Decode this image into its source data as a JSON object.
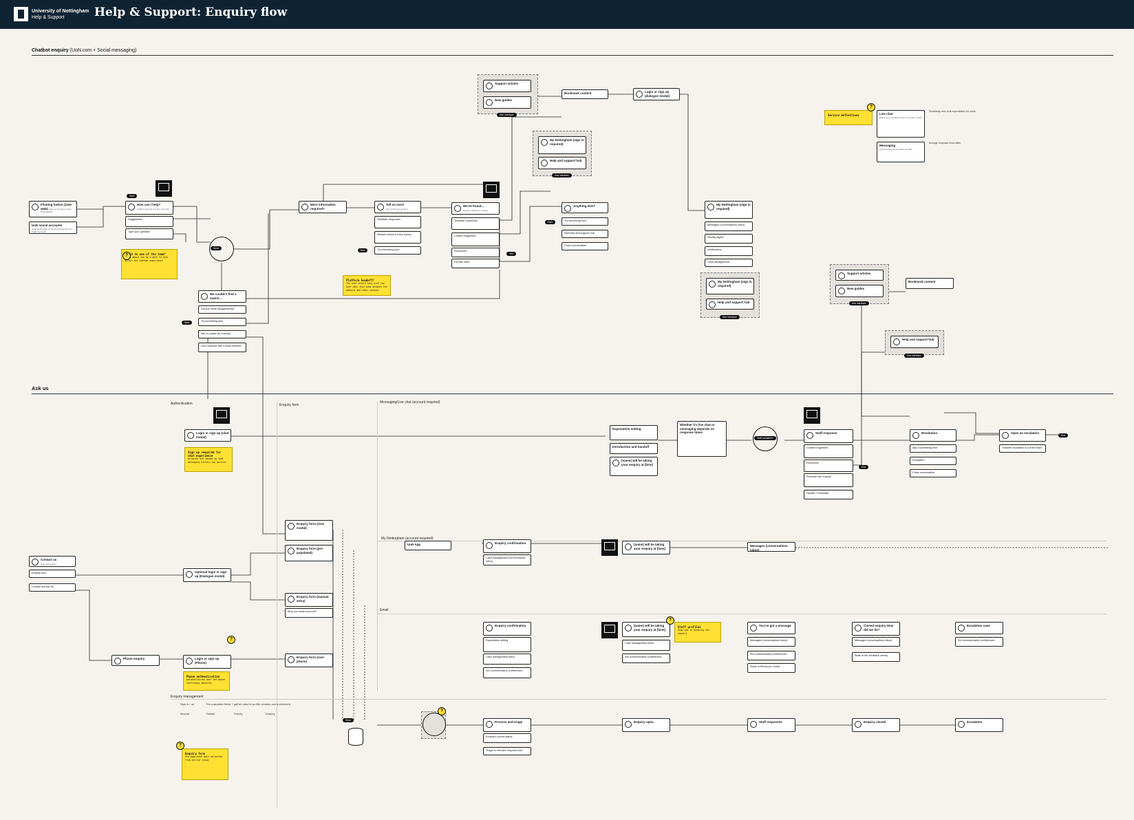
{
  "header": {
    "org_name": "University of Nottingham",
    "org_sub": "Help & Support",
    "title": "Help & Support: Enquiry flow"
  },
  "sections": {
    "chatbot": {
      "title": "Chatbot enquiry",
      "subtitle": "(UoN.com + Social messaging)"
    },
    "ask_us": {
      "title": "Ask us"
    },
    "authentication": "Authentication",
    "enquiry_form": "Enquiry form",
    "messaging": "Messaging/Live chat",
    "messaging_note": "(account required)",
    "my_nottingham": "My Nottingham",
    "my_nottingham_note": "(account required)",
    "email": "Email",
    "enquiry_management": "Enquiry management"
  },
  "chatbot_nodes": {
    "floating_button": {
      "title": "Floating button (UoN web)",
      "sub": "Visible prompt on all pages of the UoN website"
    },
    "uon_social": {
      "title": "UoN social accounts",
      "sub": "Chat functionality on the UoN Facebook and Twitter accounts"
    },
    "how_help": {
      "title": "How can I help?",
      "sub": "Chatbot greeting and free text input"
    },
    "suggestions": {
      "title": "Suggestions",
      "sub": "Popular topics and quick replies"
    },
    "type_question": {
      "title": "Type your question",
      "sub": "Natural language input"
    },
    "more_info": {
      "title": "More information required?"
    },
    "tell_us_more": {
      "title": "Tell us more",
      "sub": "Ask a follow up question"
    },
    "template_responses": {
      "title": "Template responses"
    },
    "multiple_choice": {
      "title": "Multiple choice (of key topics)"
    },
    "try_rephrasing": {
      "title": "Try rephrasing your"
    },
    "we_found": {
      "title": "We've found…",
      "sub": "Results matched to enquiry"
    },
    "template_resp2": {
      "title": "Template responses"
    },
    "content_fragments": {
      "title": "Content fragments"
    },
    "resources": {
      "title": "Resources"
    },
    "did_this_help": {
      "title": "Did this help?"
    },
    "anything_else": {
      "title": "Anything else?"
    },
    "try_something_new": {
      "title": "Try something new"
    },
    "visit_help": {
      "title": "Visit help and support hub"
    },
    "close_conversation": {
      "title": "Close conversation"
    },
    "couldnt_find": {
      "title": "We couldn't find a match…"
    },
    "did_you_mean": {
      "title": "Did you mean [suggestions]?"
    },
    "try_something_else": {
      "title": "Try something else"
    },
    "ask_us": {
      "title": "Ask us (make an enquiry)"
    },
    "live_chat": {
      "title": "Live chat/chat with a team member"
    },
    "bookmark_content": {
      "title": "Bookmark content",
      "sub": "Save this article to your account"
    },
    "login_signup_modal": {
      "title": "Login or sign up (dialogue modal)"
    },
    "support_articles": {
      "title": "Support articles"
    },
    "new_guides": {
      "title": "New guides"
    },
    "my_nottingham_signin": {
      "title": "My Nottingham (sign in required)"
    },
    "help_support_hub": {
      "title": "Help and support hub"
    },
    "my_nottingham_main": {
      "title": "My Nottingham (sign in required)"
    },
    "messages_conv": {
      "title": "Messages (conversations inbox)"
    },
    "weekly_digest": {
      "title": "Weekly digest"
    },
    "notifications": {
      "title": "Notifications"
    },
    "case_management": {
      "title": "Case Management"
    },
    "my_nottingham_2": {
      "title": "My Nottingham (sign in required)"
    },
    "help_hub_2": {
      "title": "Help and support hub"
    },
    "support_articles_2": {
      "title": "Support articles"
    },
    "new_guides_2": {
      "title": "New guides"
    },
    "bookmark_content_2": {
      "title": "Bookmark content"
    },
    "help_hub_3": {
      "title": "Help and support hub"
    }
  },
  "stickies": {
    "talk_to_team": {
      "title": "\"Talk to one of the team\"",
      "body": "Links above can be a path to help within the chatbot experience"
    },
    "platform_handoff": {
      "title": "Platform handoff?",
      "body": "The chat should stay with the user when they move between the website and their account"
    },
    "service_definitions": {
      "title": "Service definitions"
    },
    "sign_up_required": {
      "title": "Sign up required for chat experience",
      "body": "Accounts are needed so that messaging history can persist"
    },
    "phone_auth": {
      "title": "Phone authentication",
      "body": "Authentication over the phone confirming identity"
    },
    "staff_profiles": {
      "title": "Staff profiles",
      "body": "Show who is handling the enquiry"
    },
    "enquiry_form_note": {
      "title": "Enquiry form",
      "body": "Pre-populated data collected from earlier steps"
    }
  },
  "definitions": {
    "live_chat": {
      "title": "Live chat",
      "body": "Real-time conversation with a member of staff"
    },
    "messaging": {
      "title": "Messaging",
      "body": "Asynchronous conversation threads"
    },
    "note1": "Prioritising clear chat expectations for users",
    "note2": "Average response times differ"
  },
  "ask_nodes": {
    "login_signup_chat": {
      "title": "Login or sign up (chat modal)"
    },
    "contact_us": {
      "title": "Contact us",
      "sub": "Help and support"
    },
    "enquiry_form_row": {
      "title": "Enquiry form"
    },
    "contact_number": {
      "title": "Contact number for"
    },
    "optional_login": {
      "title": "Optional login or sign up (Dialogue modal)"
    },
    "phone_enquiry": {
      "title": "Phone enquiry"
    },
    "login_phone": {
      "title": "Login or sign up (Phone)"
    },
    "form_chat": {
      "title": "Enquiry form (chat modal)"
    },
    "form_prepop": {
      "title": "Enquiry form (pre-populated)"
    },
    "form_manual": {
      "title": "Enquiry form (manual entry)"
    },
    "create_account": {
      "title": "Why not create account?"
    },
    "form_phone": {
      "title": "Enquiry form (over phone)"
    },
    "expectation": {
      "title": "Expectation setting"
    },
    "introduction": {
      "title": "Introduction and handoff"
    },
    "taking_enquiry": {
      "title": "[name] will be taking your enquiry at [time]"
    },
    "whether_chat": {
      "title": "Whether it's live chat or messaging depends on response times"
    },
    "staff_response": {
      "title": "Staff response"
    },
    "content_fragments": {
      "title": "Content fragments"
    },
    "resources": {
      "title": "Resources"
    },
    "personal_info": {
      "title": "Personal info request"
    },
    "upload_download": {
      "title": "Upload / Download"
    },
    "resolution": {
      "title": "Resolution"
    },
    "ask_something_else": {
      "title": "Ask a something else"
    },
    "escalation": {
      "title": "Escalation"
    },
    "close_conversation": {
      "title": "Close conversation"
    },
    "open_escalation": {
      "title": "Open an escalation"
    },
    "transfer_escalation": {
      "title": "Transfer escalation to correct team"
    },
    "uon_app": {
      "title": "UoN App"
    },
    "enquiry_confirmation": {
      "title": "Enquiry confirmation"
    },
    "case_management_inbox": {
      "title": "Case management (conversations inbox)"
    },
    "taking_enquiry_2": {
      "title": "[name] will be taking your enquiry at [time]"
    },
    "messages_inbox": {
      "title": "Messages (conversations inbox)"
    },
    "email_confirmation": {
      "title": "Enquiry confirmation"
    },
    "expectation_email": {
      "title": "Expectation setting"
    },
    "case_mgmt_inbox": {
      "title": "Case management inbox"
    },
    "set_comm_prefs": {
      "title": "Set communication preferences"
    },
    "taking_enquiry_email": {
      "title": "[name] will be taking your enquiry at [time]"
    },
    "case_management_inbox_2": {
      "title": "Case management inbox"
    },
    "set_comm_prefs_2": {
      "title": "Set communication preferences"
    },
    "got_message": {
      "title": "You've got a message"
    },
    "messages_inbox_2": {
      "title": "Messages (conversations inbox)"
    },
    "set_comm_prefs_3": {
      "title": "Set communication preferences"
    },
    "reply_to_thread": {
      "title": "Reply to thread (or email)"
    },
    "closed_enquiry": {
      "title": "Closed enquiry How did we do?"
    },
    "messages_inbox_3": {
      "title": "Messages (conversations inbox)"
    },
    "state_of_feedback": {
      "title": "State of the feedback survey"
    },
    "escalation_case": {
      "title": "Escalation case"
    },
    "set_comm_prefs_4": {
      "title": "Set communication preferences"
    }
  },
  "management": {
    "sign_in_up": "Sign in / up",
    "prepopulates": "Pre-populates fields + gather data for profile creation and enrichment",
    "steps": [
      "Manual",
      "Details",
      "Priority",
      "Enquiry"
    ],
    "process_triage": {
      "title": "Process and triage"
    },
    "enquirys_record": {
      "title": "Enquiry's record status"
    },
    "triage_relevant": {
      "title": "Triage to relevant response hub"
    },
    "enquiry_open": {
      "title": "Enquiry open"
    },
    "staff_responses": {
      "title": "Staff responses"
    },
    "enquiry_closed": {
      "title": "Enquiry closed"
    },
    "escalation": {
      "title": "Escalation"
    }
  },
  "pills": {
    "see_interface": "See interface",
    "start": "Start",
    "yes": "Yes",
    "no": "No",
    "end": "End",
    "send": "Send",
    "staff_available": "Staff available?"
  },
  "colors": {
    "header_bg": "#0f2332",
    "sticky": "#ffe033",
    "canvas": "#f6f3ee"
  },
  "icons": [
    "logo-mark",
    "chat-icon",
    "screen-icon",
    "loop-icon",
    "database-icon",
    "question-badge-icon"
  ]
}
